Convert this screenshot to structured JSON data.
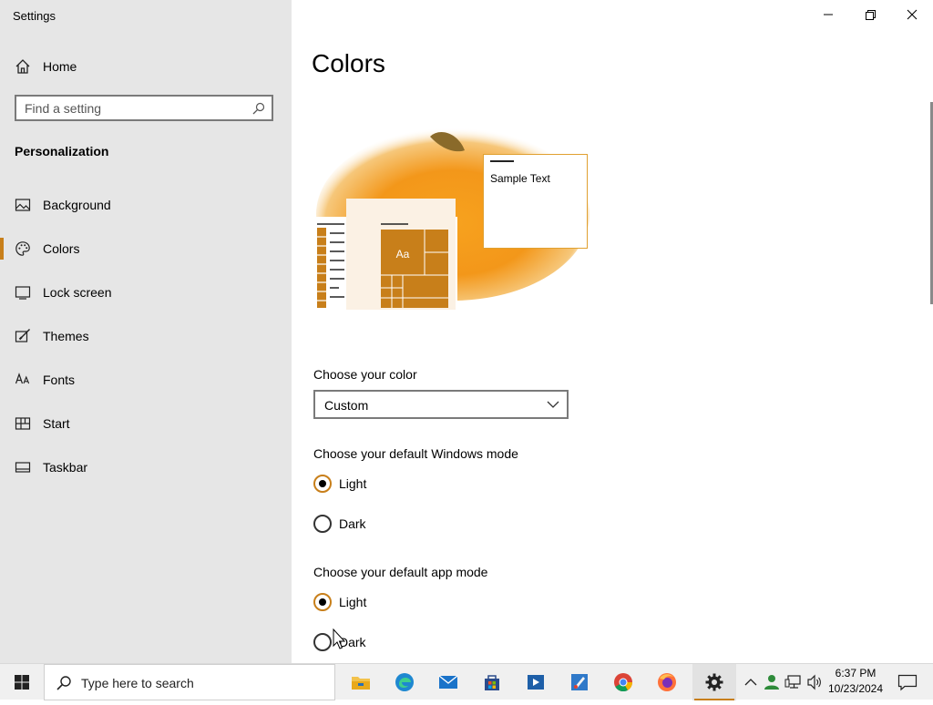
{
  "window": {
    "title": "Settings"
  },
  "sidebar": {
    "home_label": "Home",
    "search_placeholder": "Find a setting",
    "section_title": "Personalization",
    "items": [
      {
        "label": "Background",
        "icon": "picture-icon"
      },
      {
        "label": "Colors",
        "icon": "palette-icon",
        "active": true
      },
      {
        "label": "Lock screen",
        "icon": "lock-screen-icon"
      },
      {
        "label": "Themes",
        "icon": "themes-brush-icon"
      },
      {
        "label": "Fonts",
        "icon": "fonts-icon"
      },
      {
        "label": "Start",
        "icon": "start-tiles-icon"
      },
      {
        "label": "Taskbar",
        "icon": "taskbar-icon"
      }
    ]
  },
  "main": {
    "title": "Colors",
    "preview": {
      "sample_text": "Sample Text",
      "tile_text": "Aa"
    },
    "choose_color": {
      "label": "Choose your color",
      "value": "Custom"
    },
    "windows_mode": {
      "label": "Choose your default Windows mode",
      "options": [
        "Light",
        "Dark"
      ],
      "selected": "Light"
    },
    "app_mode": {
      "label": "Choose your default app mode",
      "options": [
        "Light",
        "Dark"
      ],
      "selected": "Light"
    }
  },
  "taskbar": {
    "search_text": "Type here to search",
    "apps": [
      "File Explorer",
      "Microsoft Edge",
      "Mail",
      "Microsoft Store",
      "Movies & TV",
      "Paint",
      "Google Chrome",
      "Firefox",
      "Settings"
    ],
    "time": "6:37 PM",
    "date": "10/23/2024"
  },
  "colors": {
    "accent": "#c87f1a",
    "sidebar_bg": "#e6e6e6",
    "taskbar_bg": "#f0f0f0"
  }
}
